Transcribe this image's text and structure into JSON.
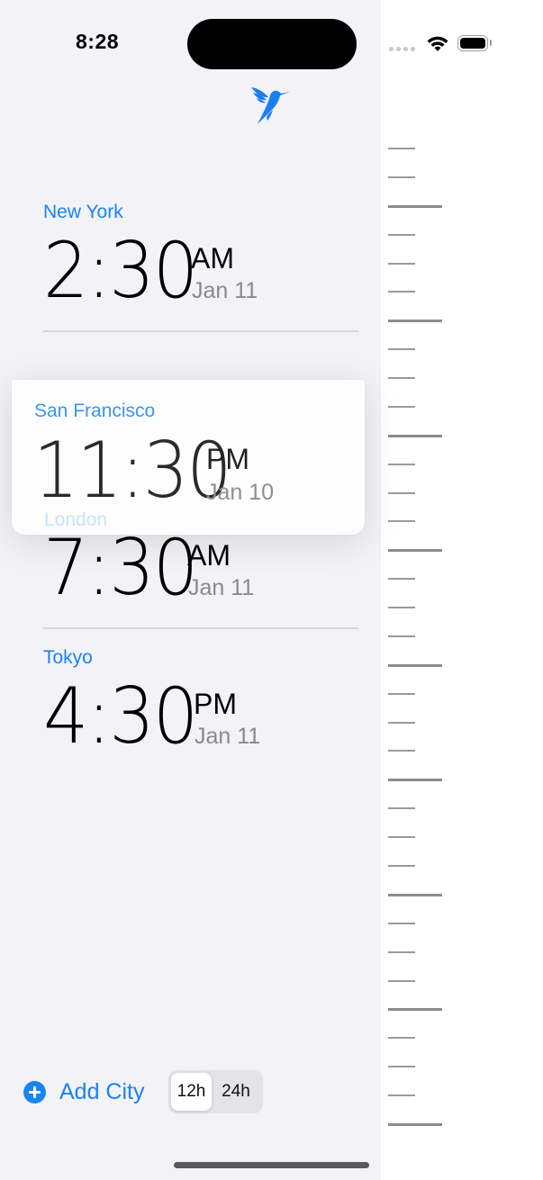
{
  "status_bar": {
    "time": "8:28",
    "icons": [
      "signal-dots-icon",
      "wifi-icon",
      "battery-icon"
    ]
  },
  "header": {
    "logo_icon": "hummingbird-icon",
    "accent_color": "#1a84f0"
  },
  "cities": [
    {
      "name": "New York",
      "time": "2:30",
      "period": "AM",
      "date": "Jan 11"
    },
    {
      "name": "London",
      "time": "7:30",
      "period": "AM",
      "date": "Jan 11"
    },
    {
      "name": "Tokyo",
      "time": "4:30",
      "period": "PM",
      "date": "Jan 11"
    }
  ],
  "dragging_card": {
    "name": "San Francisco",
    "time": "11:30",
    "period": "PM",
    "date": "Jan 10"
  },
  "bottom_bar": {
    "add_city_label": "Add City",
    "add_city_icon": "plus-circle-icon",
    "format_options": [
      "12h",
      "24h"
    ],
    "selected_format": "12h"
  },
  "ruler": {
    "tick_count": 35,
    "long_tick_every": 4
  }
}
